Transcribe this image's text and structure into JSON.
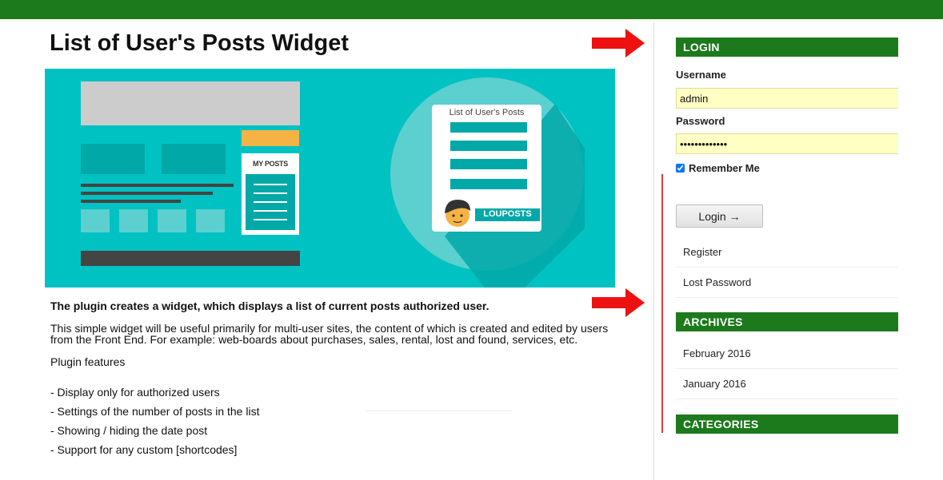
{
  "page": {
    "title": "List of User's Posts Widget"
  },
  "banner": {
    "my_posts_label": "MY POSTS",
    "card_title": "List of User's Posts",
    "brand_label": "LOUPOSTS",
    "colors": {
      "background": "#00c2c2",
      "dark_teal": "#00a8a8",
      "orange": "#f6b345",
      "dark_bar": "#444444"
    }
  },
  "content": {
    "lead": "The plugin creates a widget, which displays a list of current posts authorized user.",
    "description": "This simple widget will be useful primarily for multi-user sites, the content of which is created and edited by users from the Front End. For example: web-boards about purchases, sales, rental, lost and found, services, etc.",
    "features_title": "Plugin features",
    "features": [
      "- Display only for authorized users",
      "- Settings of the number of posts in the list",
      "- Showing / hiding the date post",
      "- Support for any custom [shortcodes]"
    ]
  },
  "sidebar": {
    "login": {
      "heading": "LOGIN",
      "username_label": "Username",
      "username_value": "admin",
      "password_label": "Password",
      "password_value": "passwordxxxxx",
      "remember_label": "Remember Me",
      "remember_checked": true,
      "button_label": "Login →",
      "links": [
        "Register",
        "Lost Password"
      ]
    },
    "archives": {
      "heading": "ARCHIVES",
      "items": [
        "February 2016",
        "January 2016"
      ]
    },
    "categories": {
      "heading": "CATEGORIES"
    }
  },
  "colors": {
    "brand_green": "#1c7a1c",
    "annotation_red": "#e23a3a",
    "input_yellow": "#ffffc4"
  }
}
